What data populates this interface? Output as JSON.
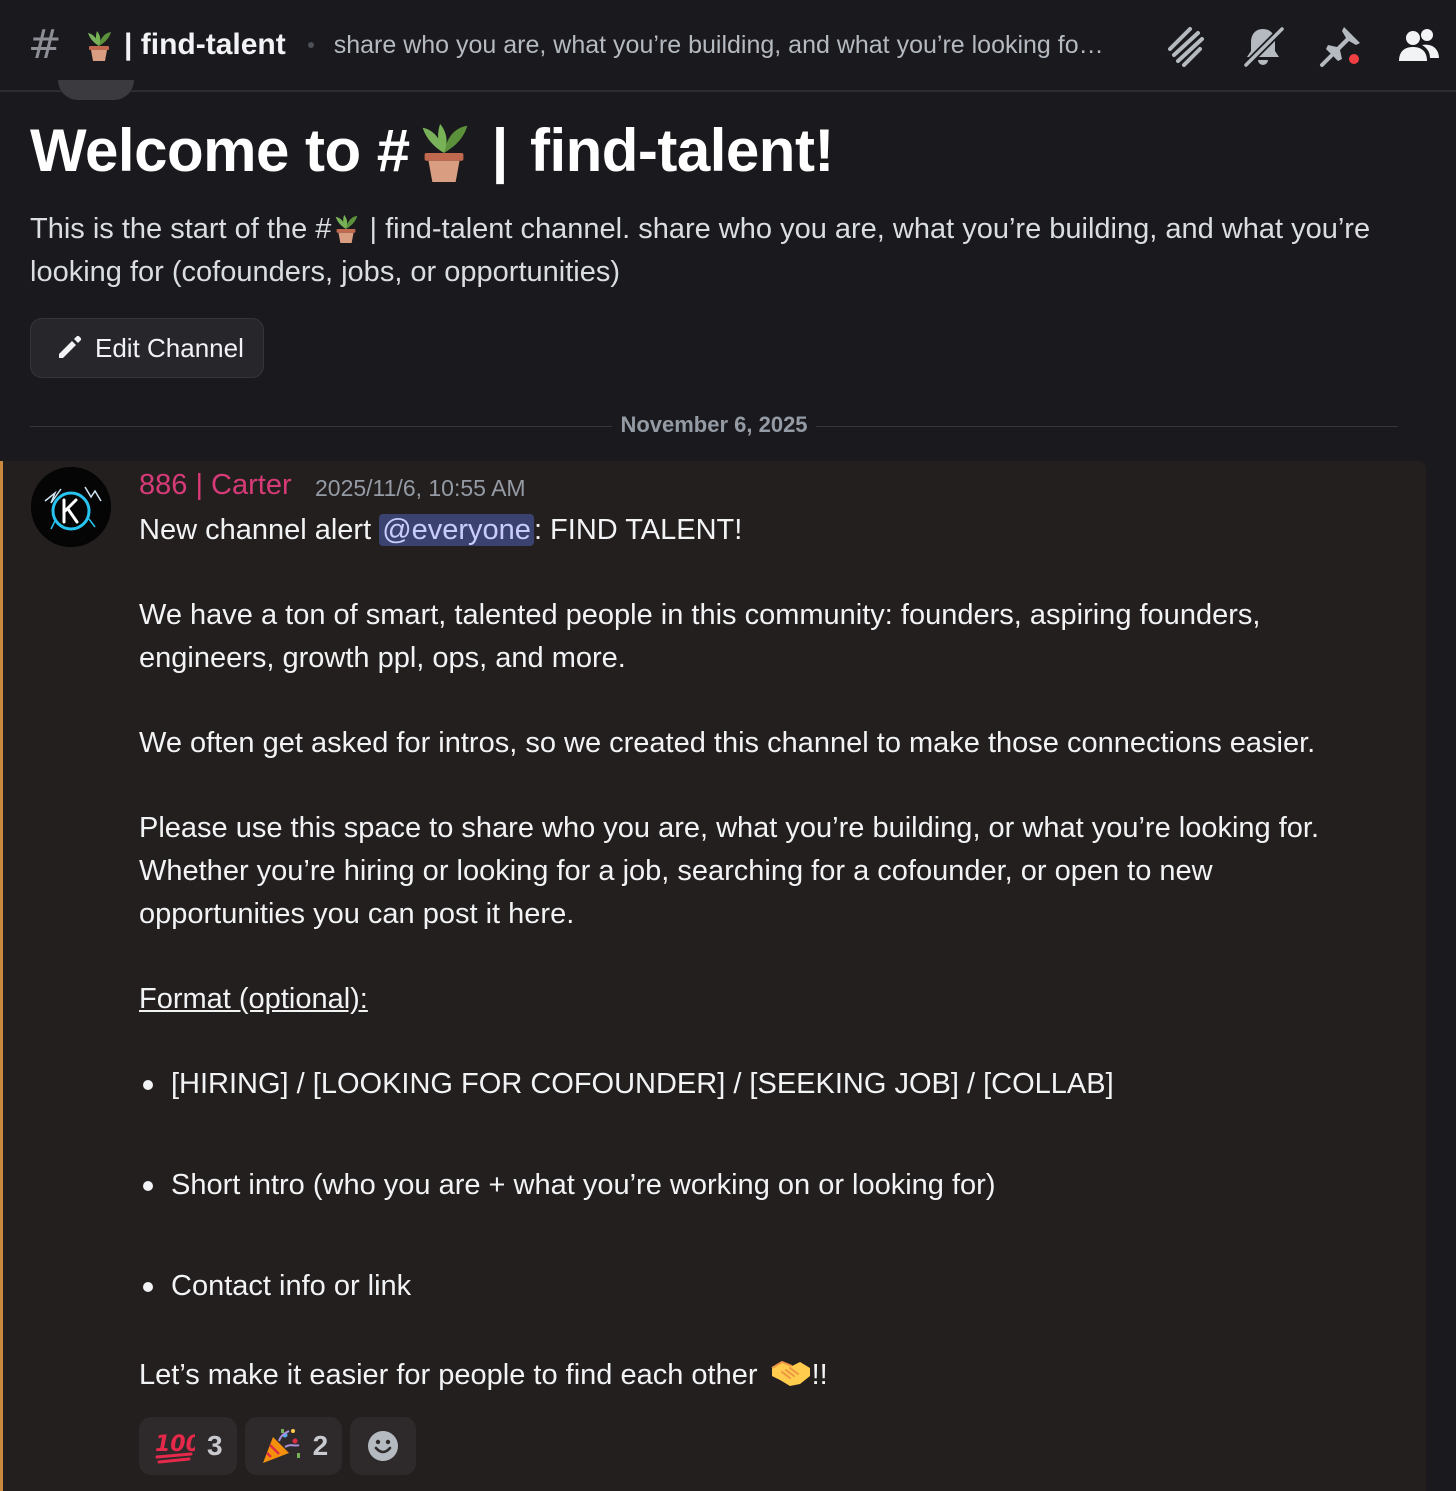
{
  "header": {
    "channel_name": "find-talent",
    "channel_prefix": "|",
    "topic": "share who you are, what you’re building, and what you’re looking fo…",
    "icons": [
      "threads-icon",
      "mute-bell-icon",
      "pin-icon",
      "member-list-icon"
    ]
  },
  "welcome": {
    "title_prefix": "Welcome to #",
    "title_suffix": "find-talent!",
    "title_bar": "|",
    "desc_before": "This is the start of the #",
    "desc_after": "find-talent channel. share who you are, what you’re building, and what you’re looking for (cofounders, jobs, or opportunities)",
    "edit_button": "Edit Channel"
  },
  "divider": {
    "date": "November 6, 2025"
  },
  "message": {
    "author": "886 | Carter",
    "timestamp": "2025/11/6, 10:55 AM",
    "line1_before": "New channel alert ",
    "mention": "@everyone",
    "line1_after": ":  FIND TALENT!",
    "para2": "We have a ton of smart, talented people in this community: founders, aspiring founders, engineers, growth ppl, ops, and more.",
    "para3": "We often get asked for intros, so we created this channel to make those connections easier.",
    "para4": "Please use this space to share who you are, what you’re building, or what you’re looking for. Whether you’re hiring or looking for a job, searching for a cofounder, or open to new opportunities you can post it here.",
    "format_heading": "Format (optional):",
    "bullets": [
      "[HIRING] / [LOOKING FOR COFOUNDER] / [SEEKING JOB] / [COLLAB]",
      "Short intro (who you are + what you’re working on or looking for)",
      "Contact info or link"
    ],
    "closing_before": "Let’s make it easier for people to find each other ",
    "closing_after": "!!",
    "reactions": [
      {
        "emoji": "hundred-points-icon",
        "count": "3"
      },
      {
        "emoji": "party-popper-icon",
        "count": "2"
      }
    ]
  },
  "colors": {
    "background": "#1a1a1e",
    "message_highlight": "#241f1f",
    "highlight_bar": "#c98a3f",
    "author": "#d63a77",
    "mention_bg": "#3c4270",
    "mention_text": "#c9cdfb"
  }
}
